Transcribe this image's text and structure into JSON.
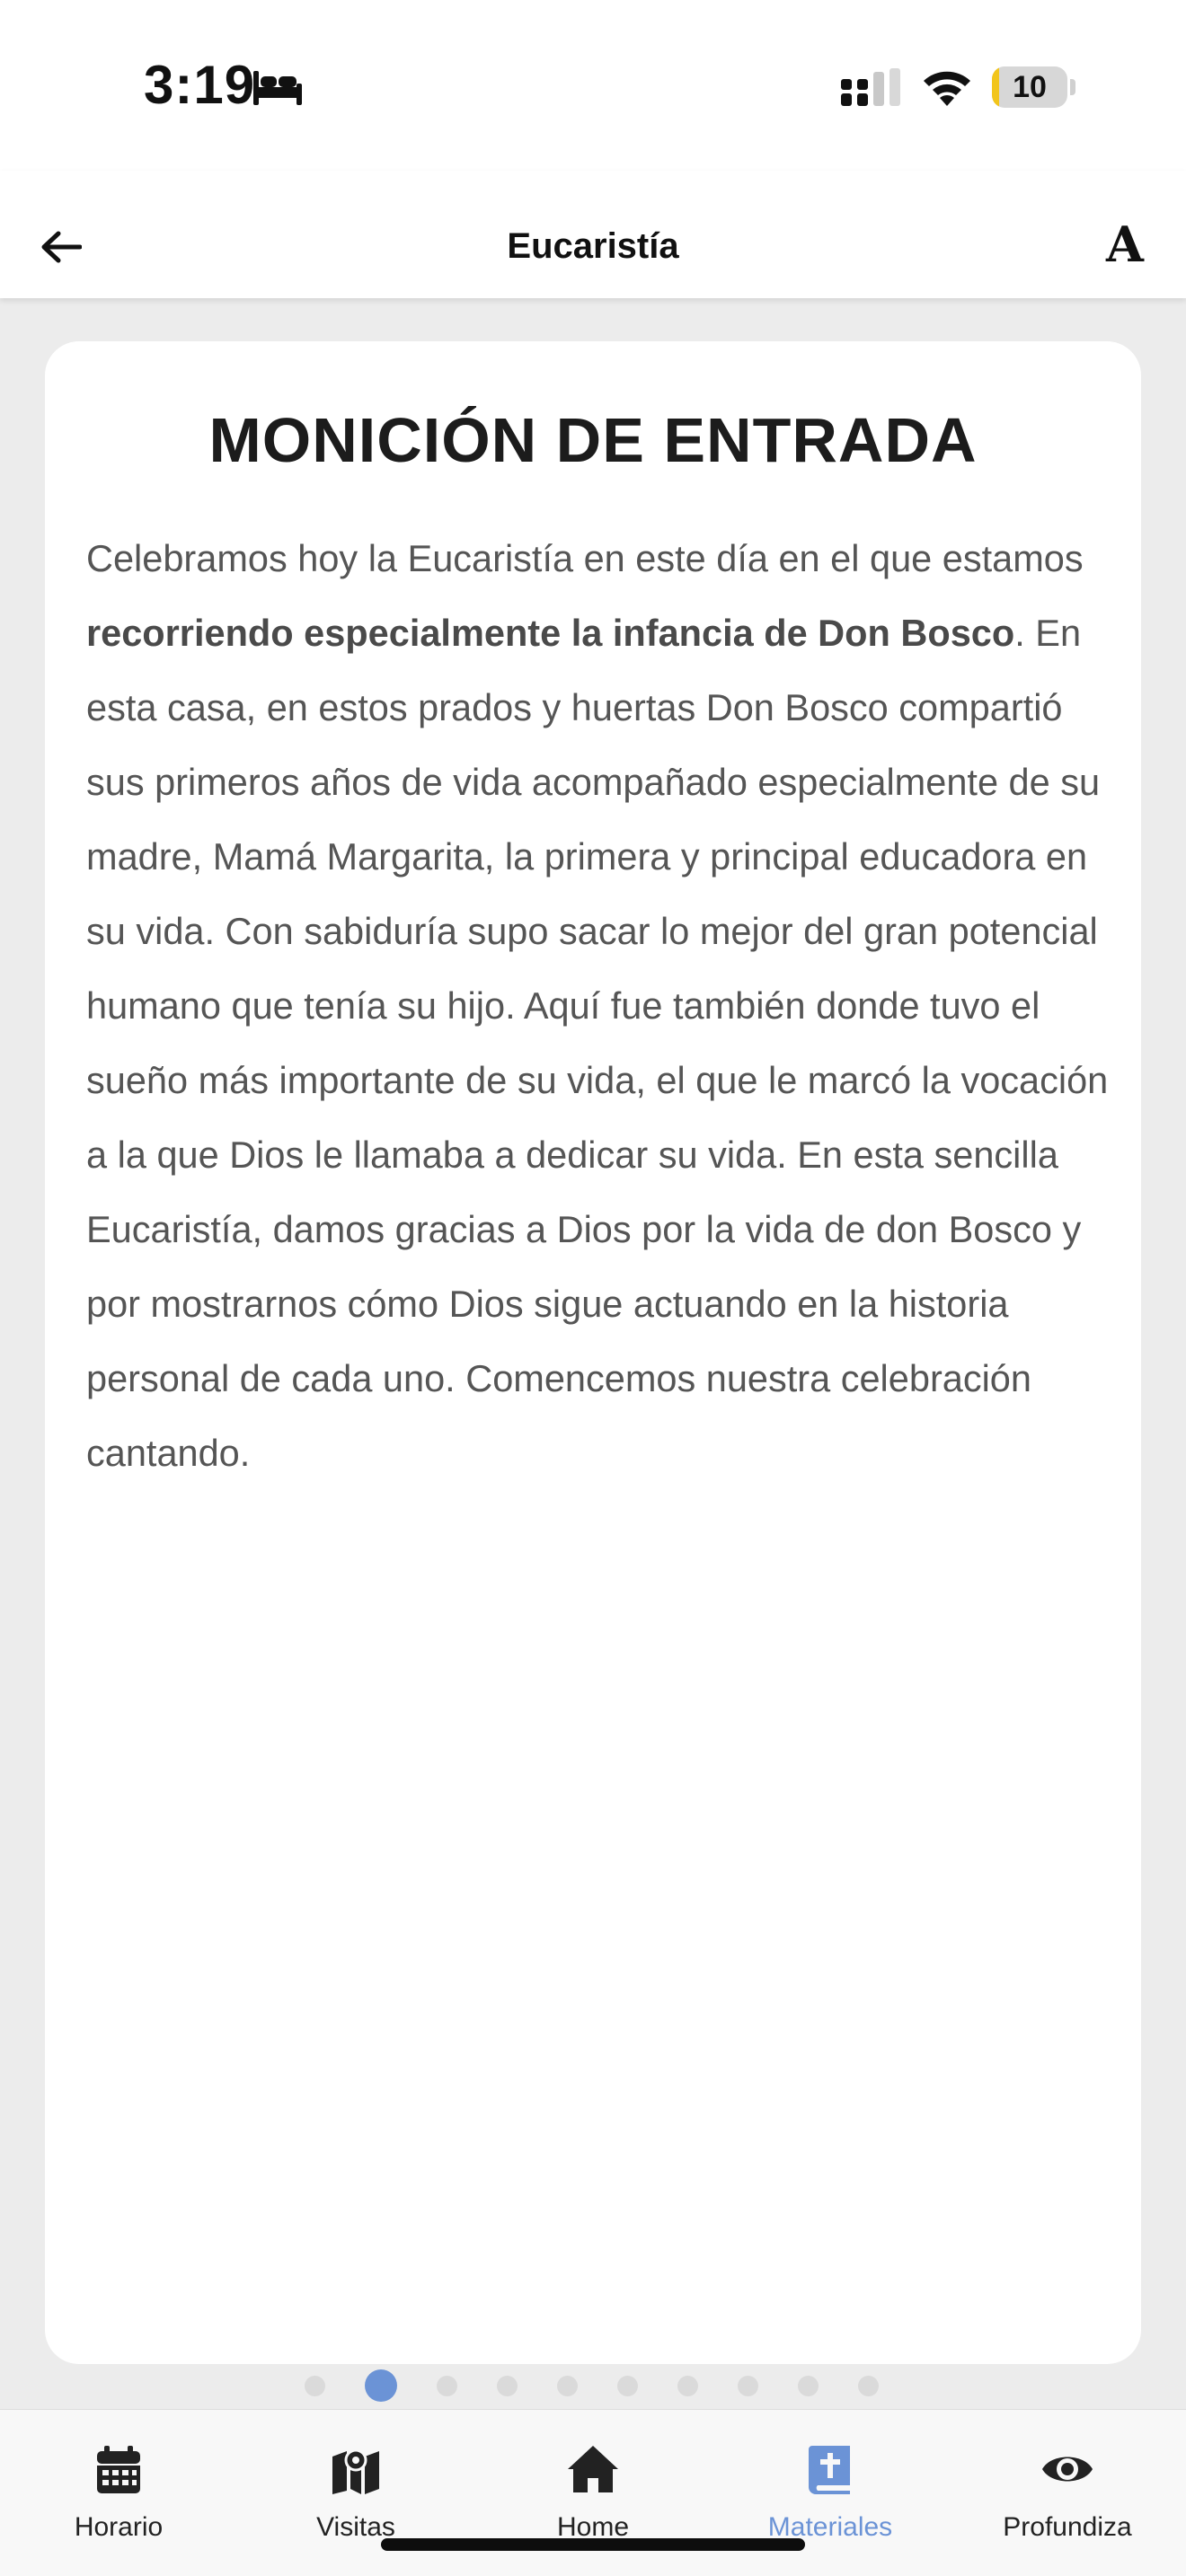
{
  "status_bar": {
    "time": "3:19",
    "battery_level": "10",
    "battery_fraction": 0.1,
    "icons": [
      "bed-icon",
      "cellular-signal-icon",
      "wifi-icon",
      "battery-icon"
    ]
  },
  "header": {
    "title": "Eucaristía",
    "back_icon": "arrow-left-icon",
    "font_size_label": "A"
  },
  "card": {
    "title": "MONICIÓN DE ENTRADA",
    "body_part1": "Celebramos hoy la Eucaristía en este día en el que estamos ",
    "body_bold": "recorriendo especialmente la infancia de Don Bosco",
    "body_part2": ". En esta casa, en estos prados y huertas Don Bosco compartió sus primeros años de vida acompañado especialmente de su madre, Mamá Margarita, la primera y principal educadora en su vida. Con sabiduría supo sacar lo mejor del gran potencial humano que tenía su hijo. Aquí fue también donde tuvo el sueño más importante de su vida, el que le marcó la vocación a la que Dios le llamaba a dedicar su vida. En esta sencilla Eucaristía, damos gracias a Dios por la vida de don Bosco y por mostrarnos cómo Dios sigue actuando en la historia personal de cada uno. Comencemos nuestra celebración cantando."
  },
  "pager": {
    "total_pages": 10,
    "current_page": 2
  },
  "tabs": [
    {
      "label": "Horario",
      "icon": "calendar-icon",
      "active": false
    },
    {
      "label": "Visitas",
      "icon": "map-icon",
      "active": false
    },
    {
      "label": "Home",
      "icon": "home-icon",
      "active": false
    },
    {
      "label": "Materiales",
      "icon": "bible-icon",
      "active": true
    },
    {
      "label": "Profundiza",
      "icon": "eye-icon",
      "active": false
    }
  ],
  "colors": {
    "accent": "#6b93d6",
    "battery": "#f2c51b",
    "background": "#ececec",
    "card": "#ffffff",
    "body_text": "#555555"
  }
}
